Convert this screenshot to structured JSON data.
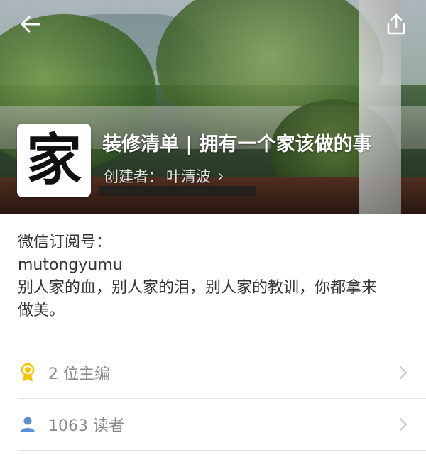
{
  "header": {
    "back_icon": "back-arrow-icon",
    "share_icon": "share-icon"
  },
  "collection": {
    "avatar_char": "家",
    "title": "装修清单 | 拥有一个家该做的事",
    "creator_prefix": "创建者：",
    "creator_name": "叶清波",
    "creator_chevron": "›"
  },
  "description": {
    "line1": "微信订阅号：",
    "line2": "mutongyumu",
    "line3": "别人家的血，别人家的泪，别人家的教训，你都拿来",
    "line4": "做美。"
  },
  "rows": [
    {
      "icon": "award-icon",
      "label": "2 位主编",
      "icon_color": "#f5c400"
    },
    {
      "icon": "user-icon",
      "label": "1063 读者",
      "icon_color": "#5a8fd6"
    }
  ]
}
